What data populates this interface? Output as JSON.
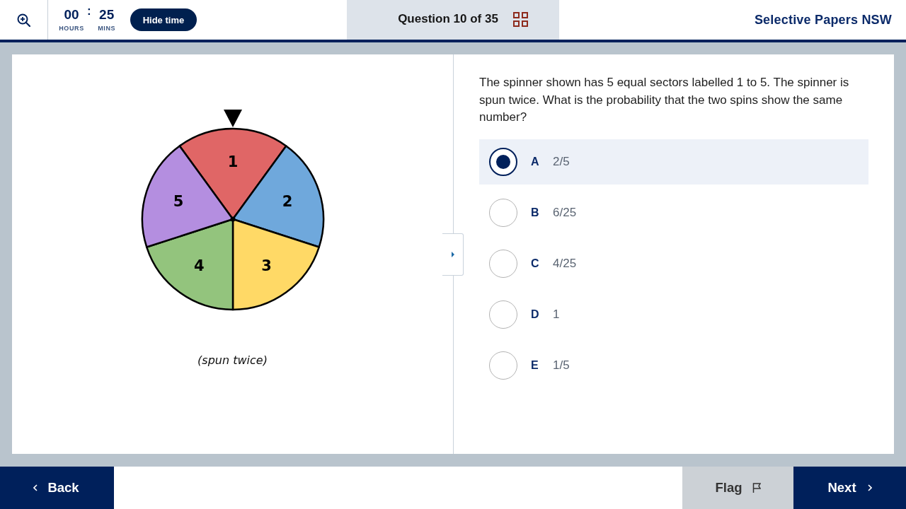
{
  "timer": {
    "hours": "00",
    "separator": ":",
    "minutes": "25",
    "hours_label": "HOURS",
    "minutes_label": "MINS",
    "toggle_button": "Hide time"
  },
  "navigator": {
    "label": "Question 10 of 35"
  },
  "brand": "Selective Papers NSW",
  "figure": {
    "sectors": [
      {
        "label": "1",
        "color": "#e06666"
      },
      {
        "label": "2",
        "color": "#6fa8dc"
      },
      {
        "label": "3",
        "color": "#ffd966"
      },
      {
        "label": "4",
        "color": "#93c47d"
      },
      {
        "label": "5",
        "color": "#b48ee0"
      }
    ],
    "caption": "(spun twice)"
  },
  "question": {
    "text": "The spinner shown has 5 equal sectors labelled 1 to 5. The spinner is spun twice. What is the probability that the two spins show the same number?",
    "options": [
      {
        "letter": "A",
        "text": "2/5",
        "selected": true
      },
      {
        "letter": "B",
        "text": "6/25",
        "selected": false
      },
      {
        "letter": "C",
        "text": "4/25",
        "selected": false
      },
      {
        "letter": "D",
        "text": "1",
        "selected": false
      },
      {
        "letter": "E",
        "text": "1/5",
        "selected": false
      }
    ]
  },
  "footer": {
    "back": "Back",
    "flag": "Flag",
    "next": "Next"
  }
}
